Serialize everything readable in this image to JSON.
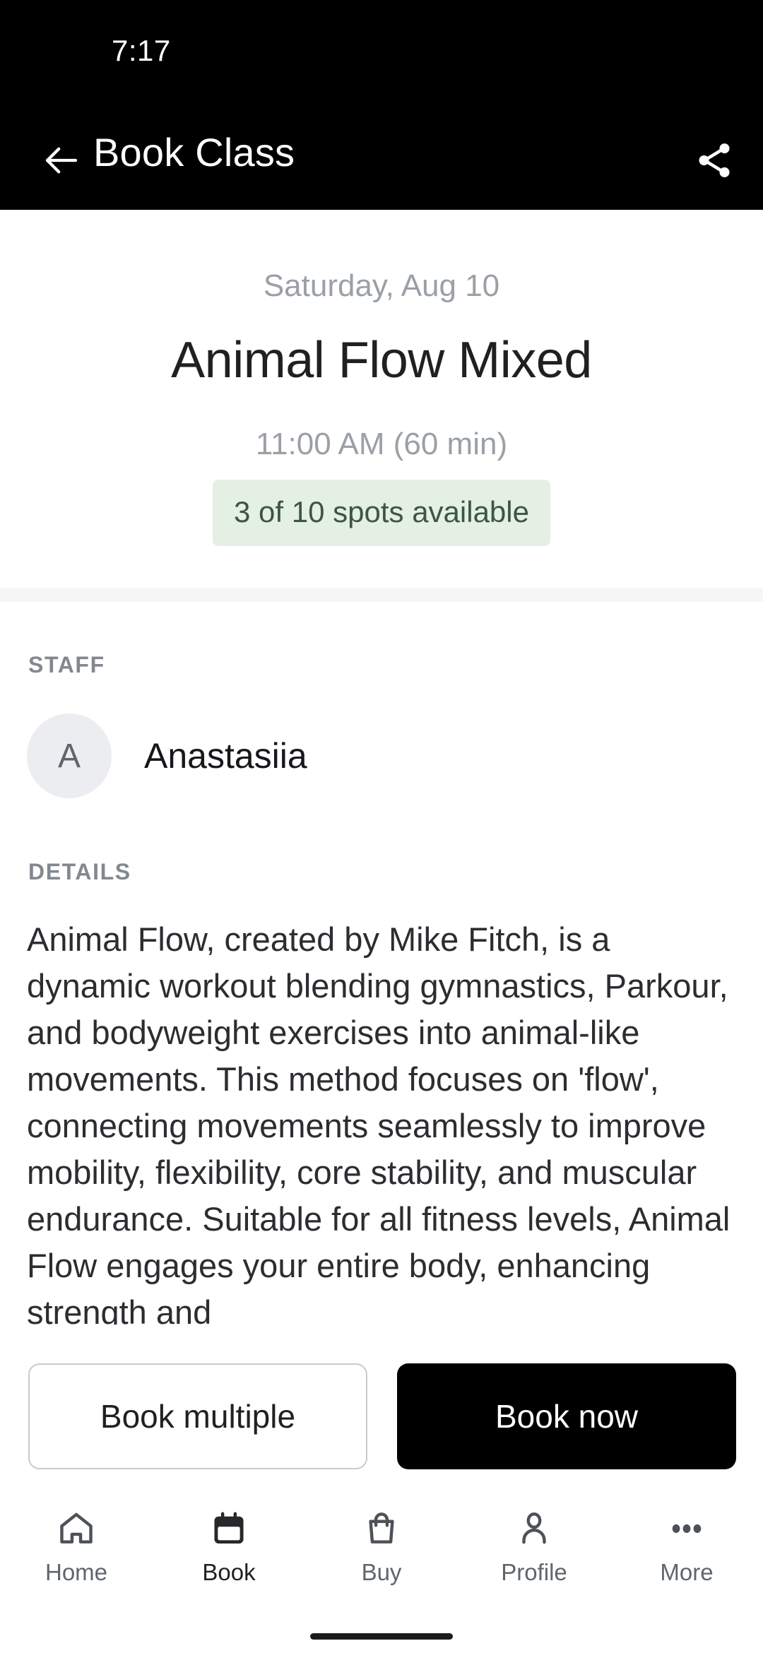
{
  "status_bar": {
    "time": "7:17"
  },
  "app_bar": {
    "title": "Book Class",
    "back_icon": "arrow-left-icon",
    "share_icon": "share-icon"
  },
  "class_summary": {
    "date": "Saturday, Aug 10",
    "title": "Animal Flow Mixed",
    "time": "11:00 AM (60 min)",
    "spots_badge": "3 of 10 spots available",
    "spots_badge_bg": "#e3f0e3",
    "spots_badge_color": "#3d5640"
  },
  "staff": {
    "label": "STAFF",
    "avatar_initial": "A",
    "name": "Anastasiia"
  },
  "details": {
    "label": "DETAILS",
    "text": "Animal Flow, created by Mike Fitch, is a dynamic workout blending gymnastics, Parkour, and bodyweight exercises into animal-like movements. This method focuses on 'flow', connecting movements seamlessly to improve mobility, flexibility, core stability, and muscular endurance. Suitable for all fitness levels, Animal Flow engages your entire body, enhancing strength and"
  },
  "actions": {
    "book_multiple_label": "Book multiple",
    "book_now_label": "Book now",
    "primary_bg": "#000000",
    "primary_color": "#ffffff"
  },
  "bottom_nav": {
    "items": [
      {
        "label": "Home",
        "icon": "home-icon",
        "active": false
      },
      {
        "label": "Book",
        "icon": "calendar-icon",
        "active": true
      },
      {
        "label": "Buy",
        "icon": "bag-icon",
        "active": false
      },
      {
        "label": "Profile",
        "icon": "person-icon",
        "active": false
      },
      {
        "label": "More",
        "icon": "ellipsis-icon",
        "active": false
      }
    ]
  }
}
